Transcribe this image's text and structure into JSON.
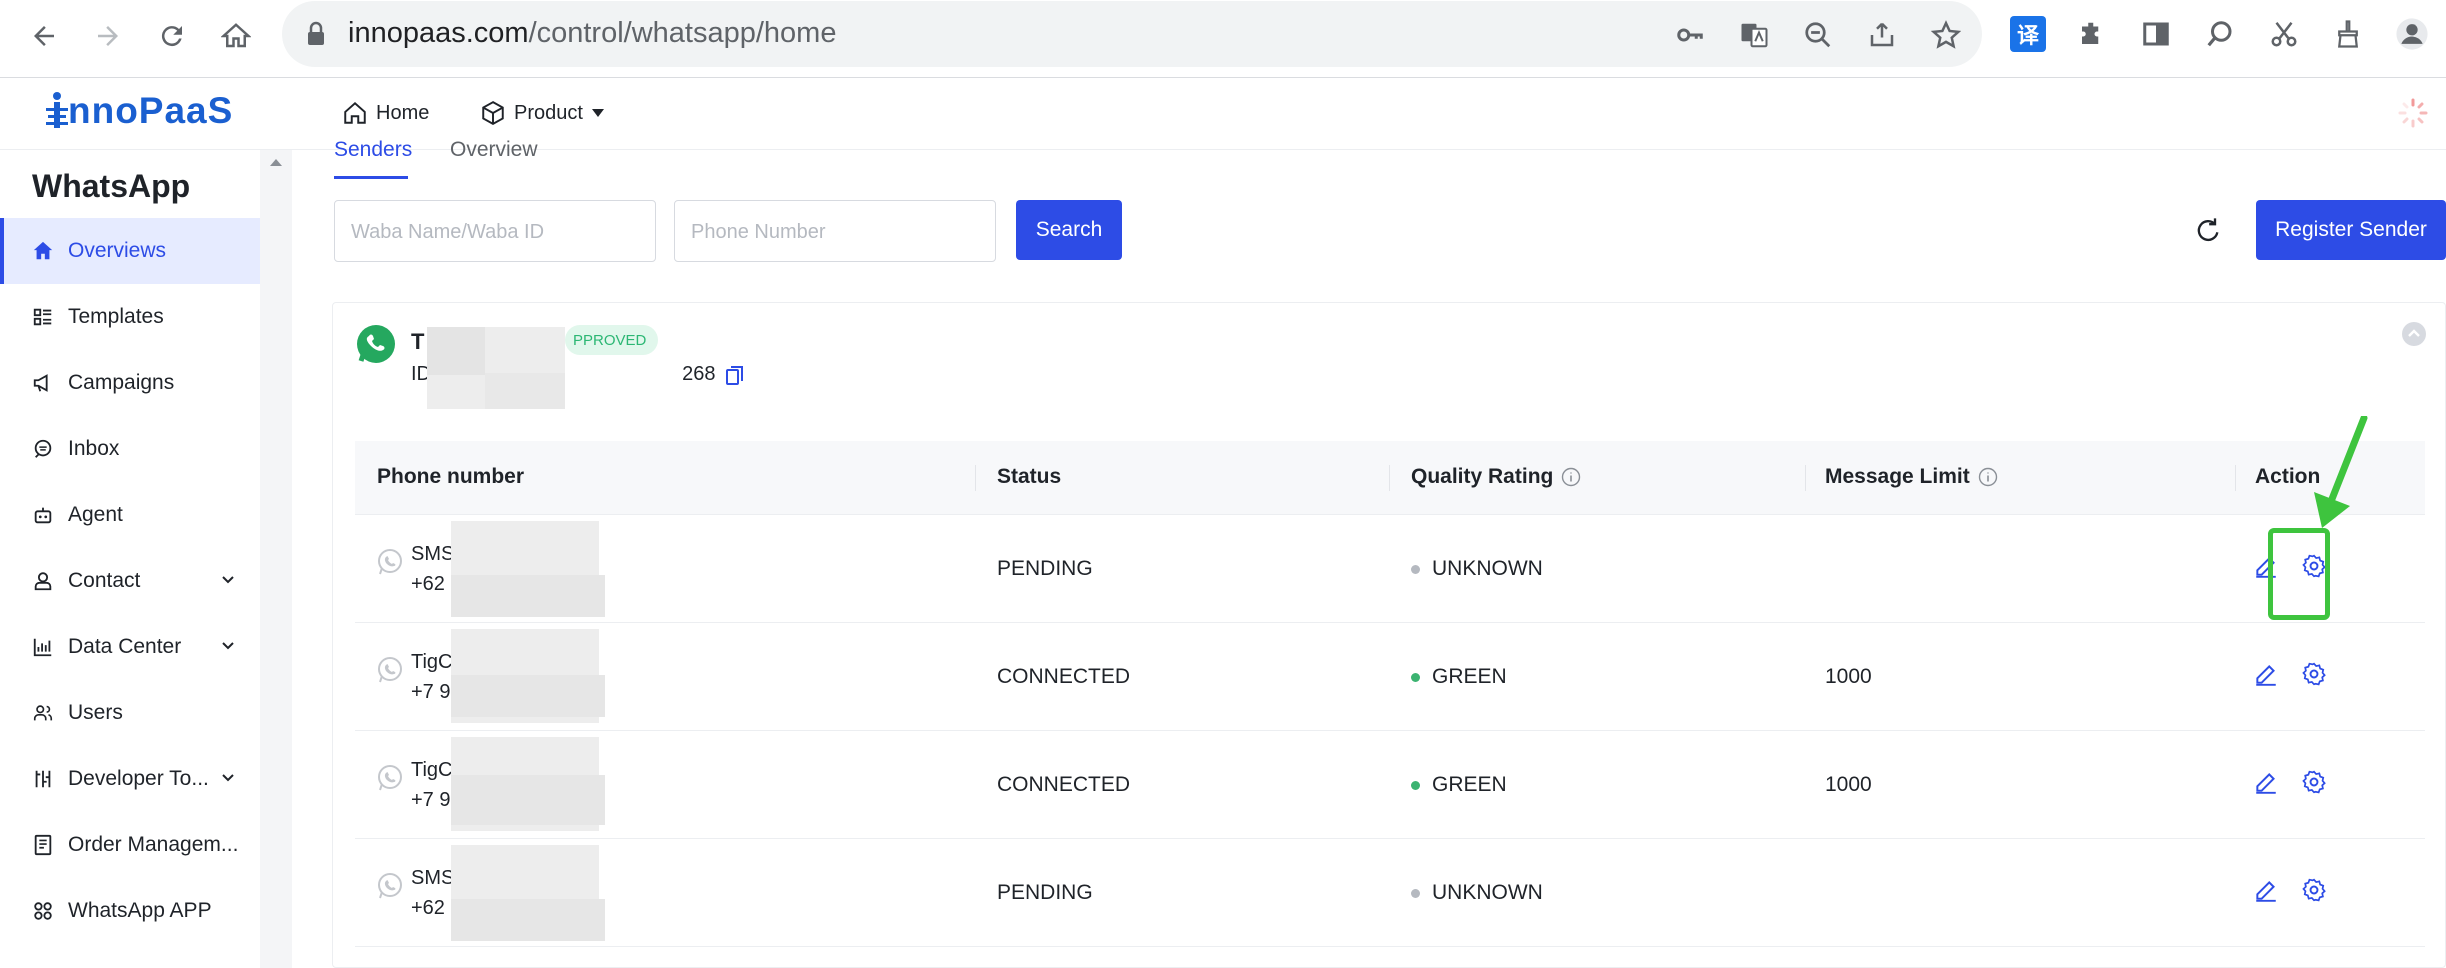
{
  "browser": {
    "url_host": "innopaas.com",
    "url_path": "/control/whatsapp/home",
    "translate_ext_label": "译"
  },
  "header": {
    "logo": "nnoPaaS",
    "nav": [
      {
        "label": "Home",
        "icon": "home-icon"
      },
      {
        "label": "Product",
        "icon": "box-icon"
      }
    ]
  },
  "sidebar": {
    "title": "WhatsApp",
    "items": [
      {
        "label": "Overviews",
        "icon": "home-icon",
        "active": true
      },
      {
        "label": "Templates",
        "icon": "list-icon"
      },
      {
        "label": "Campaigns",
        "icon": "megaphone-icon"
      },
      {
        "label": "Inbox",
        "icon": "chat-icon"
      },
      {
        "label": "Agent",
        "icon": "robot-icon"
      },
      {
        "label": "Contact",
        "icon": "user-icon",
        "expandable": true
      },
      {
        "label": "Data Center",
        "icon": "chart-icon",
        "expandable": true
      },
      {
        "label": "Users",
        "icon": "users-icon"
      },
      {
        "label": "Developer To...",
        "icon": "tools-icon",
        "expandable": true
      },
      {
        "label": "Order Managem...",
        "icon": "document-icon"
      },
      {
        "label": "WhatsApp APP",
        "icon": "apps-icon"
      }
    ]
  },
  "tabs": {
    "senders": "Senders",
    "overview": "Overview"
  },
  "search": {
    "waba_placeholder": "Waba Name/Waba ID",
    "phone_placeholder": "Phone Number",
    "search_label": "Search",
    "register_label": "Register Sender"
  },
  "waba": {
    "name": "T",
    "status": "PPROVED",
    "id_prefix": "ID",
    "id_suffix": "268"
  },
  "table": {
    "columns": [
      "Phone number",
      "Status",
      "Quality Rating",
      "Message Limit",
      "Action"
    ],
    "rows": [
      {
        "name": "SMS",
        "phone": "+62",
        "status": "PENDING",
        "quality": "UNKNOWN",
        "quality_color": "#b5b9c0",
        "limit": ""
      },
      {
        "name": "TigC",
        "phone": "+7 9",
        "status": "CONNECTED",
        "quality": "GREEN",
        "quality_color": "#3cb371",
        "limit": "1000"
      },
      {
        "name": "TigC",
        "phone": "+7 9",
        "status": "CONNECTED",
        "quality": "GREEN",
        "quality_color": "#3cb371",
        "limit": "1000"
      },
      {
        "name": "SMS",
        "phone": "+62",
        "status": "PENDING",
        "quality": "UNKNOWN",
        "quality_color": "#b5b9c0",
        "limit": ""
      }
    ]
  },
  "colors": {
    "accent": "#2d4ce6",
    "highlight": "#3ec43e",
    "whatsapp": "#25a85f"
  }
}
